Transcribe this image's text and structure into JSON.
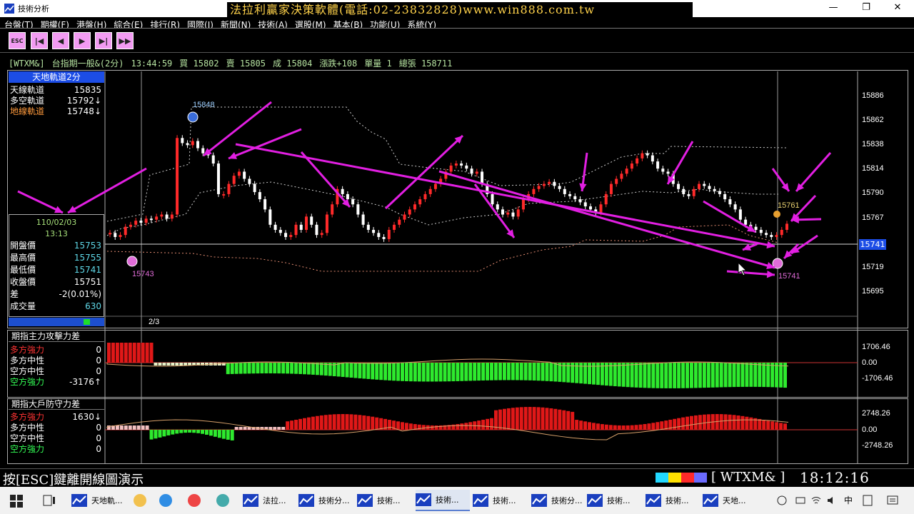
{
  "window": {
    "title": "技術分析",
    "ad_banner": "法拉利贏家決策軟體(電話:02-23832828)www.win888.com.tw",
    "minimize": "—",
    "maximize": "❐",
    "close": "✕"
  },
  "menu": [
    "台盤(T)",
    "期權(F)",
    "港盤(H)",
    "綜合(E)",
    "排行(R)",
    "國際(I)",
    "新聞(N)",
    "技術(A)",
    "選股(M)",
    "基本(B)",
    "功能(U)",
    "系統(Y)"
  ],
  "toolbar": {
    "esc": "ESC",
    "first": "|◀",
    "prev": "◀",
    "next": "▶",
    "last": "▶|",
    "end": "▶▶"
  },
  "quote": {
    "symbol": "[WTXM&]",
    "name": "台指期一般&(2分)",
    "time": "13:44:59",
    "bid": "買 15802",
    "ask": "賣 15805",
    "last": "成 15804",
    "change": "漲跌+108",
    "volume": "單量 1",
    "total": "總張 158711"
  },
  "left_panel": {
    "title": "天地軌道2分",
    "rows": [
      {
        "label": "天線軌道",
        "value": "15835",
        "color": "#ffffff"
      },
      {
        "label": "多空軌道",
        "value": "15792↓",
        "color": "#ffffff"
      },
      {
        "label": "地線軌道",
        "value": "15748↓",
        "color": "#ff9a3c"
      }
    ],
    "date": "110/02/03",
    "time": "13:13",
    "ohlc": [
      {
        "label": "開盤價",
        "value": "15753",
        "color": "#5fd8e8"
      },
      {
        "label": "最高價",
        "value": "15755",
        "color": "#5fd8e8"
      },
      {
        "label": "最低價",
        "value": "15741",
        "color": "#5fd8e8"
      },
      {
        "label": "收盤價",
        "value": "15751",
        "color": "#ffffff"
      },
      {
        "label": "差",
        "value": "-2(0.01%)",
        "color": "#ffffff"
      },
      {
        "label": "成交量",
        "value": "630",
        "color": "#5fd8e8"
      }
    ],
    "page": "2/3"
  },
  "price_axis": [
    "15886",
    "15862",
    "15838",
    "15814",
    "15790",
    "15767",
    "15741",
    "15719",
    "15695"
  ],
  "current_price_tag": "15741",
  "price_annotations": {
    "high": "15848",
    "low_left": "15743",
    "low_right": "15741",
    "right_marker": "15761"
  },
  "panel2": {
    "title": "期指主力攻擊力差",
    "rows": [
      {
        "label": "多方強力",
        "value": "0",
        "color": "#ff3333"
      },
      {
        "label": "多方中性",
        "value": "0",
        "color": "#ffffff"
      },
      {
        "label": "空方中性",
        "value": "0",
        "color": "#ffffff"
      },
      {
        "label": "空方強力",
        "value": "-3176↑",
        "color": "#33ff55"
      }
    ],
    "axis": [
      "1706.46",
      "0.00",
      "-1706.46"
    ]
  },
  "panel3": {
    "title": "期指大戶防守力差",
    "rows": [
      {
        "label": "多方強力",
        "value": "1630↓",
        "color": "#ff3333"
      },
      {
        "label": "多方中性",
        "value": "0",
        "color": "#ffffff"
      },
      {
        "label": "空方中性",
        "value": "0",
        "color": "#ffffff"
      },
      {
        "label": "空方強力",
        "value": "0",
        "color": "#33ff55"
      }
    ],
    "axis": [
      "2748.26",
      "0.00",
      "-2748.26"
    ]
  },
  "status": {
    "hint": "按[ESC]鍵離開線圖演示",
    "colors": [
      "#22d8ff",
      "#ffe000",
      "#ff2a2a",
      "#6b6bff"
    ],
    "symbol": "[ WTXM&  ]",
    "time": "18:12:16"
  },
  "taskbar": {
    "items": [
      "天地軌...",
      "法拉...",
      "技術分...",
      "技術...",
      "技術...",
      "技術...",
      "技術分...",
      "技術...",
      "技術...",
      "天地..."
    ],
    "ime": "中"
  }
}
